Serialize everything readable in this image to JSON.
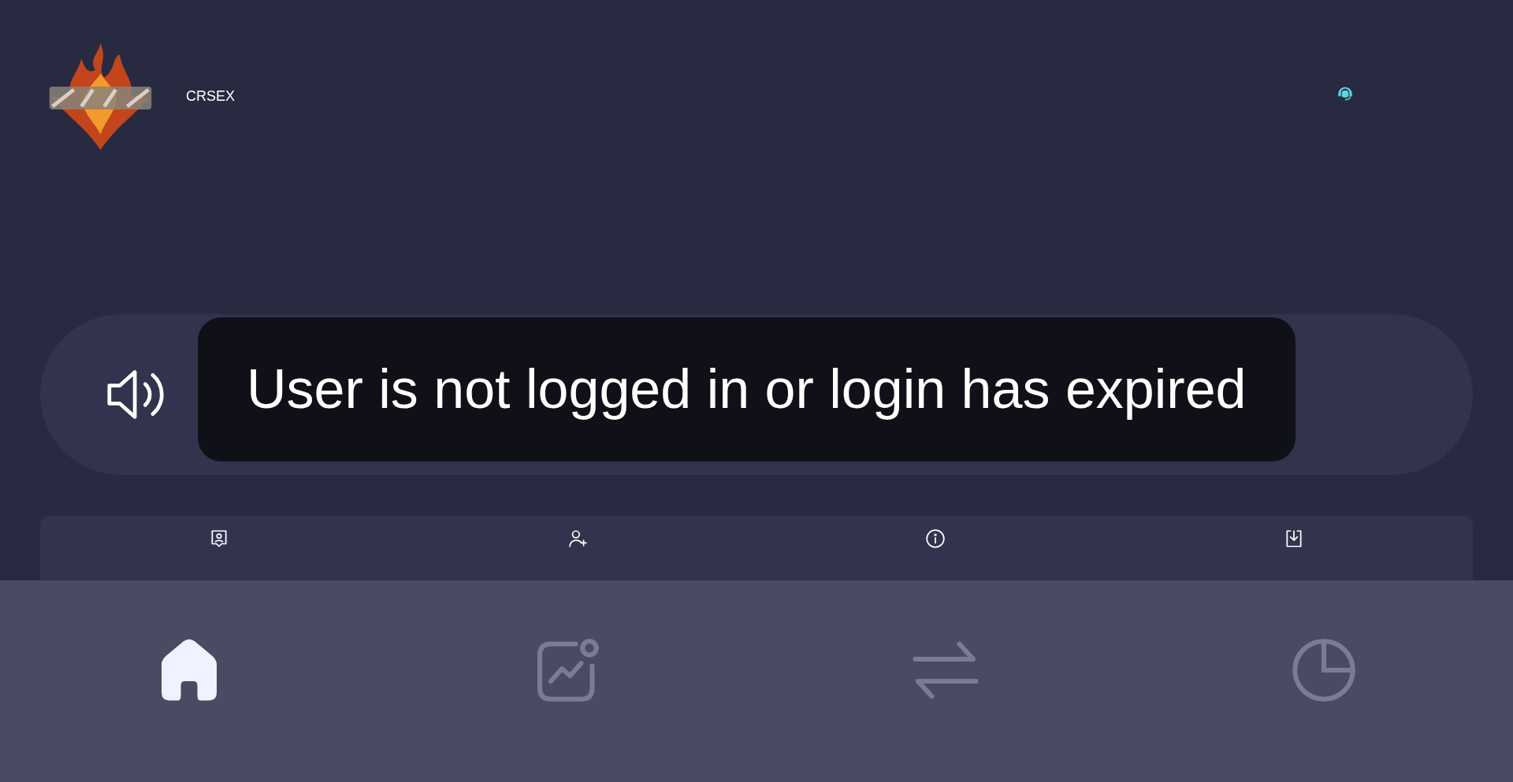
{
  "header": {
    "brand": "CRSEX"
  },
  "notice": {
    "message": "User is not logged in or login has expired"
  },
  "menu": [
    {
      "kind": "profile"
    },
    {
      "kind": "add-user"
    },
    {
      "kind": "info"
    },
    {
      "kind": "download"
    }
  ],
  "bottom_nav": [
    {
      "kind": "home",
      "selected": true
    },
    {
      "kind": "chart",
      "selected": false
    },
    {
      "kind": "transfer",
      "selected": false
    },
    {
      "kind": "pie",
      "selected": false
    }
  ]
}
